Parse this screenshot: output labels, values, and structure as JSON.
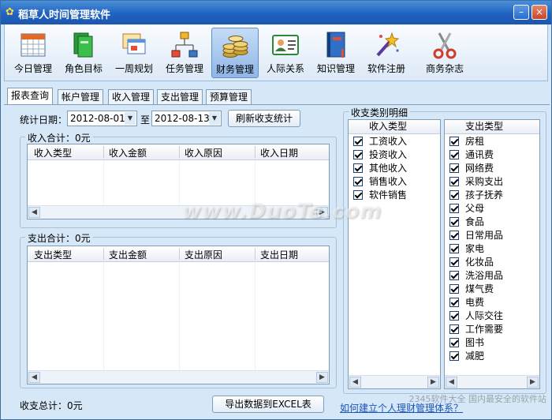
{
  "window": {
    "title": "稻草人时间管理软件",
    "minimize": "–",
    "close": "×"
  },
  "toolbar": [
    {
      "label": "今日管理",
      "icon": "calendar-icon"
    },
    {
      "label": "角色目标",
      "icon": "books-icon"
    },
    {
      "label": "一周规划",
      "icon": "windows-icon"
    },
    {
      "label": "任务管理",
      "icon": "org-chart-icon"
    },
    {
      "label": "财务管理",
      "icon": "coins-icon",
      "active": true
    },
    {
      "label": "人际关系",
      "icon": "contact-card-icon"
    },
    {
      "label": "知识管理",
      "icon": "book-icon"
    },
    {
      "label": "软件注册",
      "icon": "magic-wand-icon"
    },
    {
      "label": "商务杂志",
      "icon": "scissors-icon"
    }
  ],
  "tabs": [
    "报表查询",
    "帐户管理",
    "收入管理",
    "支出管理",
    "预算管理"
  ],
  "filter": {
    "date_label": "统计日期：",
    "from": "2012-08-01",
    "to_label": "至",
    "to": "2012-08-13",
    "refresh_button": "刷新收支统计"
  },
  "income": {
    "title": "收入合计：0元",
    "columns": [
      "收入类型",
      "收入金额",
      "收入原因",
      "收入日期"
    ]
  },
  "expense": {
    "title": "支出合计：0元",
    "columns": [
      "支出类型",
      "支出金额",
      "支出原因",
      "支出日期"
    ]
  },
  "total": "收支总计：0元",
  "export_button": "导出数据到EXCEL表",
  "detail": {
    "title": "收支类别明细",
    "income_header": "收入类型",
    "income_items": [
      "工资收入",
      "投资收入",
      "其他收入",
      "销售收入",
      "软件销售"
    ],
    "expense_header": "支出类型",
    "expense_items": [
      "房租",
      "通讯费",
      "网络费",
      "采购支出",
      "孩子抚养",
      "父母",
      "食品",
      "日常用品",
      "家电",
      "化妆品",
      "洗浴用品",
      "煤气费",
      "电费",
      "人际交往",
      "工作需要",
      "图书",
      "减肥"
    ]
  },
  "help_link": "如何建立个人理财管理体系？",
  "watermarks": {
    "main": "www.DuoTe.com",
    "corner": "2345软件大全 国内最安全的软件站"
  },
  "colors": {
    "titlebar": "#1f62c0",
    "background": "#d6e7f7",
    "link": "#1a55b8"
  }
}
